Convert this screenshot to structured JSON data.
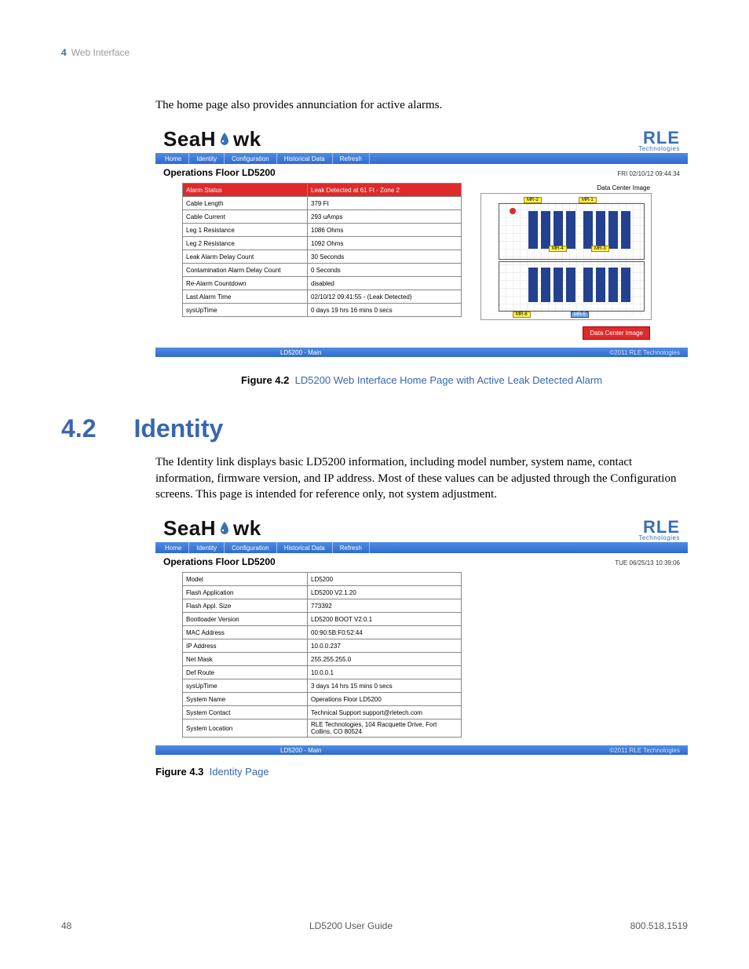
{
  "runhead": {
    "num": "4",
    "label": "Web Interface"
  },
  "intro1": "The home page also provides annunciation for active alarms.",
  "brand": {
    "sea_pre": "SeaH",
    "sea_post": "wk",
    "rle": "RLE",
    "rle_sub": "Technologies"
  },
  "tabs": [
    "Home",
    "Identity",
    "Configuration",
    "Historical Data",
    "Refresh"
  ],
  "ss1": {
    "page_title": "Operations Floor LD5200",
    "timestamp": "FRI 02/10/12 09:44:34",
    "rows": [
      {
        "k": "Alarm Status",
        "v": "Leak Detected at 61 Ft - Zone 2",
        "alarm": true
      },
      {
        "k": "Cable Length",
        "v": "379 Ft"
      },
      {
        "k": "Cable Current",
        "v": "293 uAmps"
      },
      {
        "k": "Leg 1 Resistance",
        "v": "1086 Ohms"
      },
      {
        "k": "Leg 2 Resistance",
        "v": "1092 Ohms"
      },
      {
        "k": "Leak Alarm Delay Count",
        "v": "30 Seconds"
      },
      {
        "k": "Contamination Alarm Delay Count",
        "v": "0 Seconds"
      },
      {
        "k": "Re-Alarm Countdown",
        "v": "disabled"
      },
      {
        "k": "Last Alarm Time",
        "v": "02/10/12 09:41:55  -  (Leak Detected)"
      },
      {
        "k": "sysUpTime",
        "v": "0 days 19 hrs 16 mins 0 secs"
      }
    ],
    "map_title": "Data Center Image",
    "map_link": "Data Center Image",
    "racklabels": [
      "MR-2",
      "MR-1",
      "MR-4",
      "MR-3",
      "MR-6",
      "MR-5"
    ],
    "footer_center": "LD5200 - Main",
    "footer_right": "©2011 RLE Technologies"
  },
  "fig1": {
    "b": "Figure 4.2",
    "t": "LD5200 Web Interface Home Page with Active Leak Detected Alarm"
  },
  "section": {
    "num": "4.2",
    "title": "Identity"
  },
  "intro2": "The Identity link displays basic LD5200 information, including model number, system name, contact information, firmware version, and IP address. Most of these values can be adjusted through the Configuration screens. This page is intended for reference only, not system adjustment.",
  "ss2": {
    "page_title": "Operations Floor LD5200",
    "timestamp": "TUE 06/25/13 10:39:06",
    "rows": [
      {
        "k": "Model",
        "v": "LD5200"
      },
      {
        "k": "Flash Application",
        "v": "LD5200 V2.1.20"
      },
      {
        "k": "Flash Appl. Size",
        "v": "773392"
      },
      {
        "k": "Bootloader Version",
        "v": "LD5200 BOOT V2.0.1"
      },
      {
        "k": "MAC Address",
        "v": "00:90:5B:F0:52:44"
      },
      {
        "k": "IP Address",
        "v": "10.0.0.237"
      },
      {
        "k": "Net Mask",
        "v": "255.255.255.0"
      },
      {
        "k": "Def Route",
        "v": "10.0.0.1"
      },
      {
        "k": "sysUpTime",
        "v": "3 days 14 hrs 15 mins 0 secs"
      },
      {
        "k": "System Name",
        "v": "Operations Floor LD5200"
      },
      {
        "k": "System Contact",
        "v": "Technical Support support@rletech.com"
      },
      {
        "k": "System Location",
        "v": "RLE Technologies, 104 Racquette Drive, Fort Collins, CO 80524"
      }
    ],
    "footer_center": "LD5200 - Main",
    "footer_right": "©2011 RLE Technologies"
  },
  "fig2": {
    "b": "Figure 4.3",
    "t": "Identity Page"
  },
  "footer": {
    "page": "48",
    "center": "LD5200 User Guide",
    "right": "800.518.1519"
  }
}
